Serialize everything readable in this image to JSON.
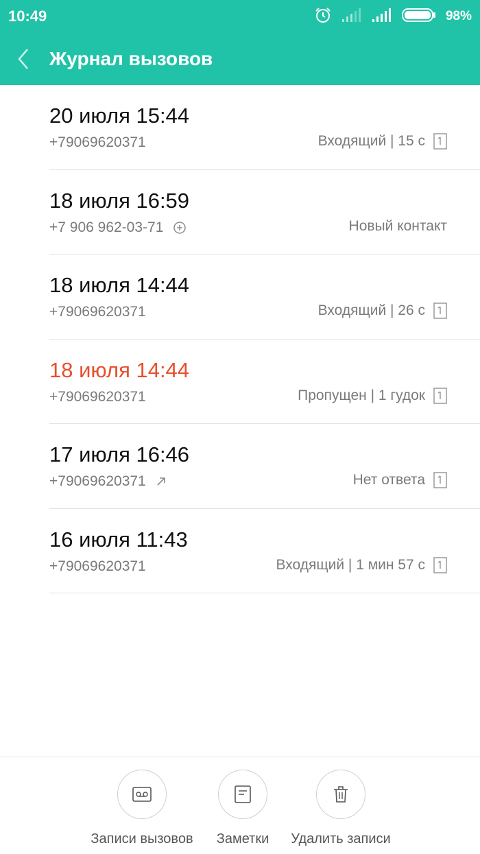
{
  "status_bar": {
    "time": "10:49",
    "battery": "98%",
    "icons": [
      "alarm-icon",
      "signal-icon",
      "signal-icon",
      "battery-icon"
    ]
  },
  "header": {
    "title": "Журнал вызовов",
    "color": "#21c3a8"
  },
  "calls": [
    {
      "date": "20 июля 15:44",
      "number": "+79069620371",
      "info": "Входящий | 15 с",
      "missed": false,
      "icon": "",
      "detail_icon": true
    },
    {
      "date": "18 июля 16:59",
      "number": "+7 906 962-03-71",
      "info": "Новый контакт",
      "missed": false,
      "icon": "add-circle-icon",
      "detail_icon": false
    },
    {
      "date": "18 июля 14:44",
      "number": "+79069620371",
      "info": "Входящий | 26 с",
      "missed": false,
      "icon": "",
      "detail_icon": true
    },
    {
      "date": "18 июля 14:44",
      "number": "+79069620371",
      "info": "Пропущен | 1 гудок",
      "missed": true,
      "icon": "",
      "detail_icon": true
    },
    {
      "date": "17 июля 16:46",
      "number": "+79069620371",
      "info": "Нет ответа",
      "missed": false,
      "icon": "outgoing-arrow-icon",
      "detail_icon": true
    },
    {
      "date": "16 июля 11:43",
      "number": "+79069620371",
      "info": "Входящий | 1 мин 57 с",
      "missed": false,
      "icon": "",
      "detail_icon": true
    }
  ],
  "missed_color": "#e84f2a",
  "actions": [
    {
      "label": "Записи вызовов",
      "icon": "voicemail-icon"
    },
    {
      "label": "Заметки",
      "icon": "note-icon"
    },
    {
      "label": "Удалить записи",
      "icon": "trash-icon"
    }
  ]
}
